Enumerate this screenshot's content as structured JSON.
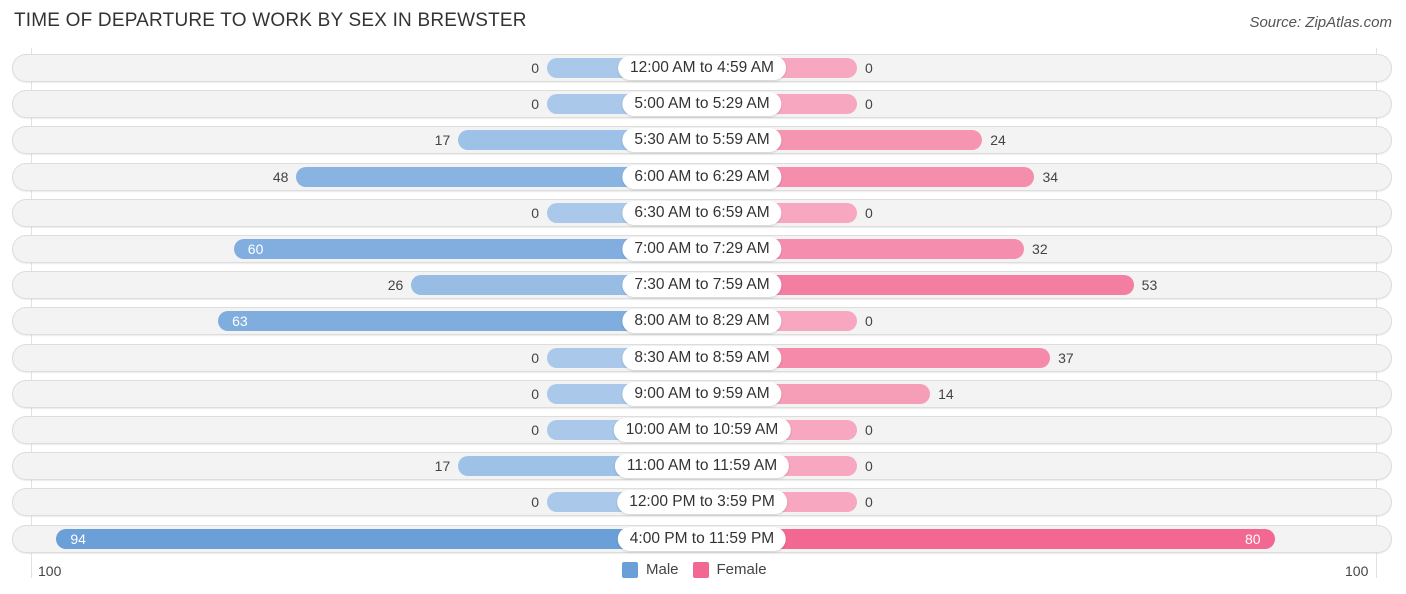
{
  "title": "TIME OF DEPARTURE TO WORK BY SEX IN BREWSTER",
  "source": "Source: ZipAtlas.com",
  "colors": {
    "male": "#6a9fd8",
    "male_light": "#a9c8ea",
    "female": "#f26892",
    "female_light": "#f7a8c0"
  },
  "chart_data": {
    "type": "bar",
    "orientation": "horizontal-diverging",
    "title": "TIME OF DEPARTURE TO WORK BY SEX IN BREWSTER",
    "categories": [
      "12:00 AM to 4:59 AM",
      "5:00 AM to 5:29 AM",
      "5:30 AM to 5:59 AM",
      "6:00 AM to 6:29 AM",
      "6:30 AM to 6:59 AM",
      "7:00 AM to 7:29 AM",
      "7:30 AM to 7:59 AM",
      "8:00 AM to 8:29 AM",
      "8:30 AM to 8:59 AM",
      "9:00 AM to 9:59 AM",
      "10:00 AM to 10:59 AM",
      "11:00 AM to 11:59 AM",
      "12:00 PM to 3:59 PM",
      "4:00 PM to 11:59 PM"
    ],
    "series": [
      {
        "name": "Male",
        "values": [
          0,
          0,
          17,
          48,
          0,
          60,
          26,
          63,
          0,
          0,
          0,
          17,
          0,
          94
        ]
      },
      {
        "name": "Female",
        "values": [
          0,
          0,
          24,
          34,
          0,
          32,
          53,
          0,
          37,
          14,
          0,
          0,
          0,
          80
        ]
      }
    ],
    "axis": {
      "left_label": "100",
      "right_label": "100",
      "range": [
        0,
        100
      ]
    },
    "legend": {
      "position": "bottom-center",
      "entries": [
        "Male",
        "Female"
      ]
    },
    "grid": false
  }
}
